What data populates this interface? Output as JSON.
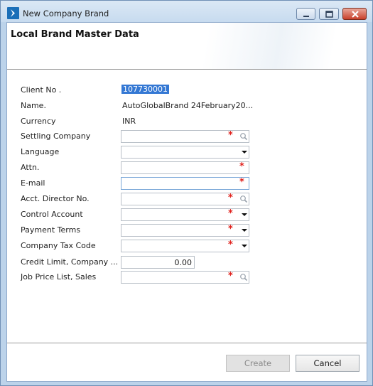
{
  "window": {
    "title": "New Company Brand"
  },
  "page": {
    "title": "Local Brand Master Data"
  },
  "form": {
    "client_no": {
      "label": "Client No .",
      "value": "107730001"
    },
    "name": {
      "label": "Name.",
      "value": "AutoGlobalBrand 24February20..."
    },
    "currency": {
      "label": "Currency",
      "value": "INR"
    },
    "settling_company": {
      "label": "Settling Company",
      "value": ""
    },
    "language": {
      "label": "Language",
      "value": ""
    },
    "attn": {
      "label": "Attn.",
      "value": ""
    },
    "email": {
      "label": "E-mail",
      "value": ""
    },
    "acct_director_no": {
      "label": "Acct. Director No.",
      "value": ""
    },
    "control_account": {
      "label": "Control Account",
      "value": ""
    },
    "payment_terms": {
      "label": "Payment Terms",
      "value": ""
    },
    "company_tax_code": {
      "label": "Company Tax Code",
      "value": ""
    },
    "credit_limit": {
      "label": "Credit Limit, Company ...",
      "value": "0.00"
    },
    "job_price_list_sales": {
      "label": "Job Price List, Sales",
      "value": ""
    }
  },
  "required_mark": "*",
  "buttons": {
    "create": "Create",
    "cancel": "Cancel"
  },
  "colors": {
    "accent": "#3478d4",
    "required": "#e0201b"
  }
}
